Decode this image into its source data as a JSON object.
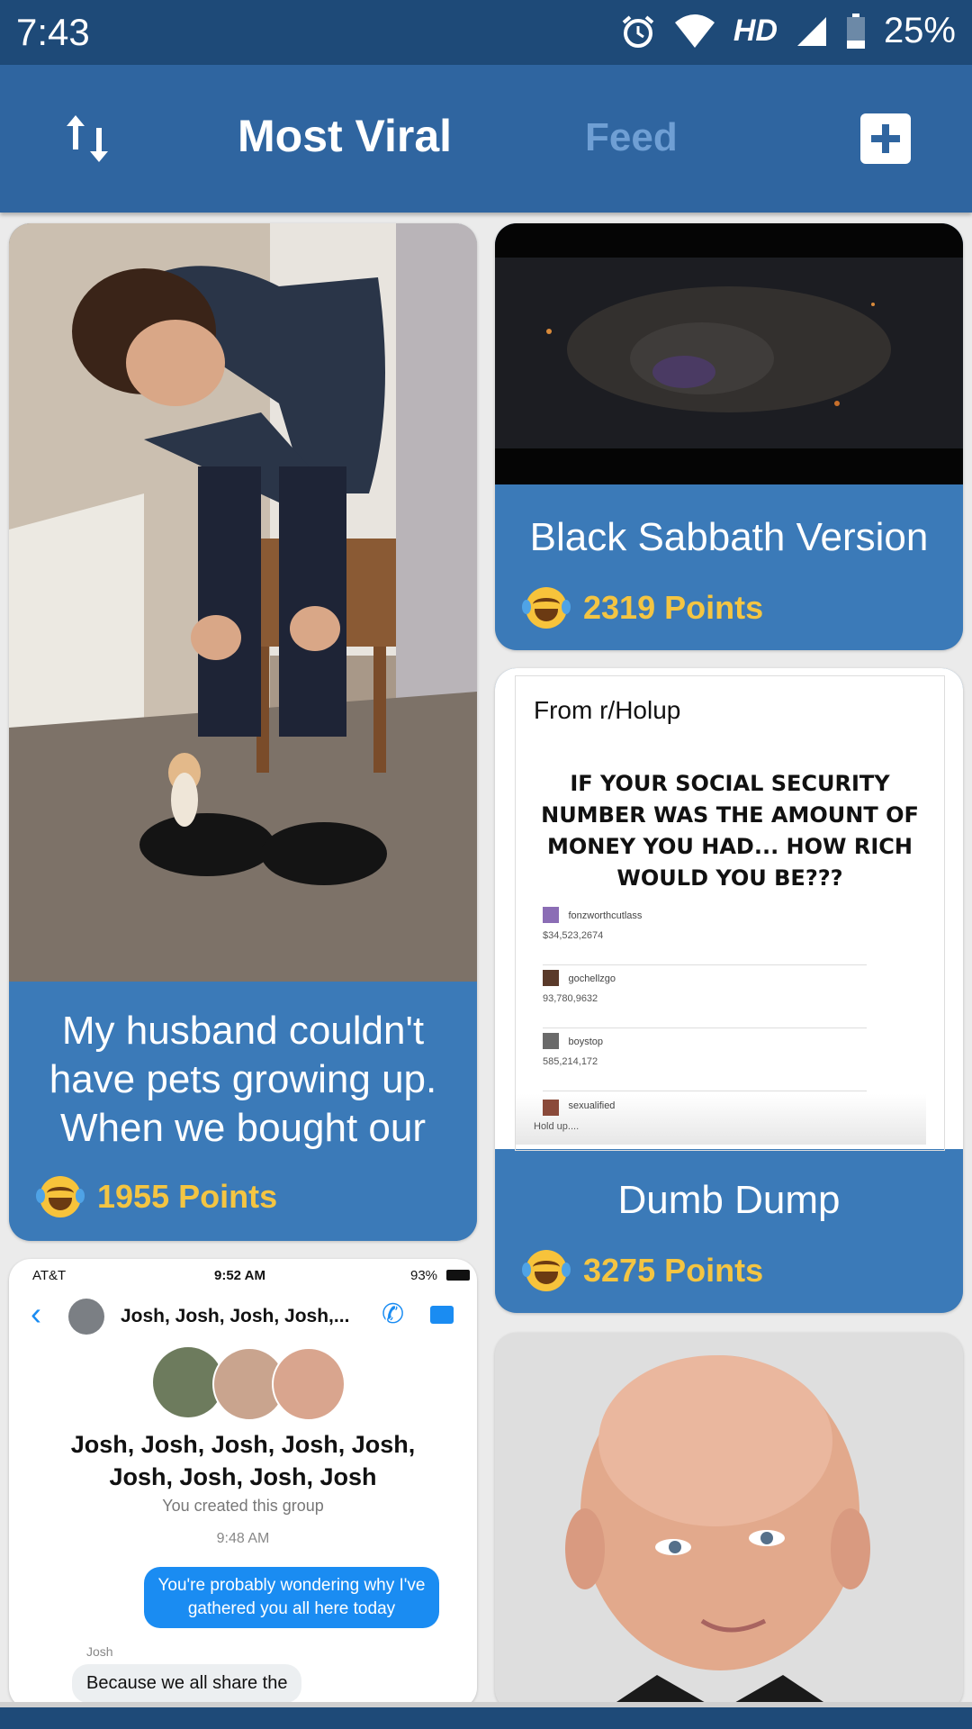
{
  "status_bar": {
    "time": "7:43",
    "network": "HD",
    "battery": "25%",
    "icons": [
      "alarm-icon",
      "wifi-icon",
      "signal-icon",
      "battery-icon"
    ]
  },
  "app_bar": {
    "sort_icon": "sort-arrows-icon",
    "active_tab": "Most Viral",
    "other_tab": "Feed",
    "add_icon": "plus-icon"
  },
  "colors": {
    "status_bar": "#1e4a78",
    "app_bar": "#2f65a0",
    "card": "#3b7ab8",
    "points": "#f4c542",
    "inactive_tab": "#6f9fd4"
  },
  "posts": [
    {
      "caption": "My husband couldn't have pets growing up. When we bought our",
      "points": "1955 Points",
      "reaction_icon": "laughing-tears-emoji-icon"
    },
    {
      "caption": "Black Sabbath Version",
      "points": "2319 Points",
      "reaction_icon": "laughing-tears-emoji-icon"
    },
    {
      "caption": "Dumb Dump",
      "points": "3275 Points",
      "reaction_icon": "laughing-tears-emoji-icon",
      "image_text": {
        "source": "From r/Holup",
        "headline": "IF YOUR SOCIAL SECURITY NUMBER WAS THE AMOUNT OF MONEY YOU HAD... HOW RICH WOULD YOU BE???",
        "replies": [
          {
            "user": "fonzworthcutlass",
            "value": "$34,523,2674"
          },
          {
            "user": "gochellzgo",
            "value": "93,780,9632"
          },
          {
            "user": "boystop",
            "value": "585,214,172"
          },
          {
            "user": "sexualified",
            "value": "Hold up...."
          }
        ]
      }
    },
    {
      "image_text": {
        "carrier": "AT&T",
        "time": "9:52 AM",
        "battery": "93%",
        "group_header": "Josh, Josh, Josh, Josh,...",
        "group_name": "Josh, Josh, Josh, Josh, Josh, Josh, Josh, Josh, Josh",
        "created": "You created this group",
        "timestamp": "9:48 AM",
        "sent_message": "You're probably wondering why I've gathered you all here today",
        "reply_sender": "Josh",
        "reply_message": "Because we all share the"
      }
    },
    {
      "image": "bald-man-portrait"
    }
  ]
}
